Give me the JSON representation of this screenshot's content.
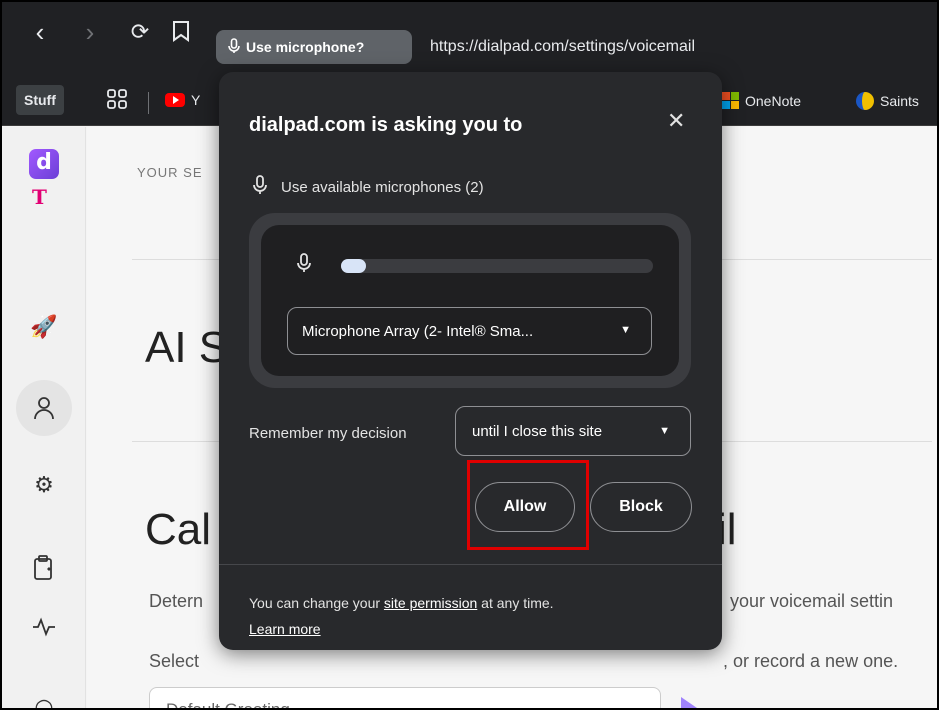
{
  "browser": {
    "permission_chip": "Use microphone?",
    "url": "https://dialpad.com/settings/voicemail",
    "bookmarks": {
      "stuff": "Stuff",
      "partial_y": "Y",
      "onenote": "OneNote",
      "saints": "Saints"
    }
  },
  "page": {
    "section_label": "YOUR SE",
    "ai_heading": "AI S",
    "cal_heading": "Cal",
    "il_fragment": "il",
    "desc_left": "Detern",
    "desc_right": "your voicemail settin",
    "select_left": "Select",
    "select_right": ", or record a new one.",
    "greeting_dropdown": "Default Greeting"
  },
  "popup": {
    "title": "dialpad.com is asking you to",
    "permission": "Use available microphones (2)",
    "mic_level_fraction": 0.08,
    "mic_select": "Microphone Array (2- Intel® Sma...",
    "remember_label": "Remember my decision",
    "remember_select": "until I close this site",
    "allow_label": "Allow",
    "block_label": "Block",
    "footer_prefix": "You can change your ",
    "footer_link": "site permission",
    "footer_suffix": " at any time.",
    "learn_more": "Learn more"
  },
  "colors": {
    "chrome_bg": "#202124",
    "popup_bg": "#28292c",
    "highlight": "#e00000",
    "dialpad_brand": "#7c52ff",
    "tmobile": "#e20074"
  }
}
